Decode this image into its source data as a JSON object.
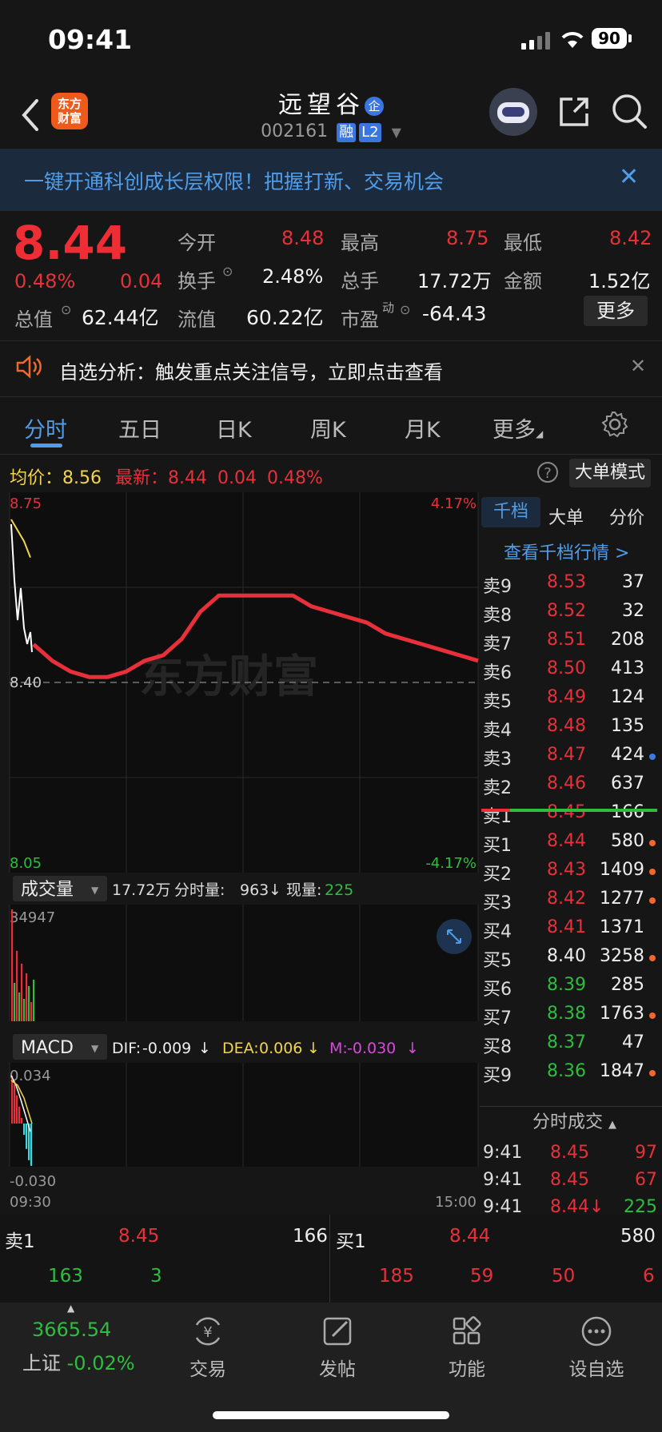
{
  "status_bar": {
    "time": "09:41",
    "battery": "90"
  },
  "header": {
    "logo_text": "东方\n财富",
    "stock_name": "远望谷",
    "badge_corp": "企",
    "stock_code": "002161",
    "tag_margin": "融",
    "tag_level": "L2"
  },
  "banner": {
    "text": "一键开通科创成长层权限！把握打新、交易机会"
  },
  "quote": {
    "price": "8.44",
    "change_pct": "0.48%",
    "change_abs": "0.04",
    "open_label": "今开",
    "open": "8.48",
    "high_label": "最高",
    "high": "8.75",
    "low_label": "最低",
    "low": "8.42",
    "turnover_label": "换手",
    "turnover": "2.48%",
    "volume_label": "总手",
    "volume": "17.72万",
    "amount_label": "金额",
    "amount": "1.52亿",
    "mktcap_label": "总值",
    "mktcap": "62.44亿",
    "float_label": "流值",
    "float": "60.22亿",
    "pe_label": "市盈",
    "pe_sup": "动",
    "pe": "-64.43",
    "more_label": "更多"
  },
  "notice": {
    "text": "自选分析：触发重点关注信号，立即点击查看"
  },
  "tabs": [
    {
      "label": "分时",
      "active": true
    },
    {
      "label": "五日"
    },
    {
      "label": "日K"
    },
    {
      "label": "周K"
    },
    {
      "label": "月K"
    },
    {
      "label": "更多"
    }
  ],
  "chart_info": {
    "avg_label": "均价：",
    "avg": "8.56",
    "latest_label": "最新：",
    "latest": "8.44",
    "latest_change": "0.04",
    "latest_pct": "0.48%",
    "big_order_mode": "大单模式",
    "watermark": "东方财富"
  },
  "chart_data": [
    {
      "type": "line",
      "title": "",
      "y_axis_left_labels": [
        "8.75",
        "8.40",
        "8.05"
      ],
      "y_axis_right_labels": [
        "4.17%",
        "-4.17%"
      ],
      "ylim": [
        8.05,
        8.75
      ],
      "reference_price": 8.4,
      "x_labels": [
        "09:30",
        "15:00"
      ],
      "series": [
        {
          "name": "",
          "values": [
            8.47,
            8.44,
            8.42,
            8.41,
            8.41,
            8.42,
            8.44,
            8.45,
            8.48,
            8.53,
            8.56,
            8.56,
            8.56,
            8.56,
            8.56,
            8.54,
            8.53,
            8.52,
            8.51,
            8.49,
            8.48,
            8.47,
            8.46,
            8.45,
            8.44
          ]
        },
        {
          "name": "",
          "values": [
            8.7,
            8.68,
            8.66,
            8.63
          ]
        }
      ]
    },
    {
      "type": "bar",
      "title": "成交量",
      "total": "17.72万",
      "minute_vol_label": "分时量:",
      "minute_vol": "963",
      "now_vol_label": "现量:",
      "now_vol": "225",
      "y_max_label": "34947",
      "values": [
        34947,
        12000,
        22000,
        9000,
        18000,
        7000,
        15000,
        11000,
        6000,
        13000
      ]
    },
    {
      "type": "bar",
      "title": "MACD",
      "dif_label": "DIF:",
      "dif": "-0.009",
      "dea_label": "DEA:",
      "dea": "0.006",
      "m_label": "M:",
      "m": "-0.030",
      "y_labels": [
        "0.034",
        "-0.030"
      ],
      "values": [
        0.034,
        0.028,
        0.02,
        0.012,
        0.004,
        -0.008,
        -0.018,
        -0.026,
        -0.03
      ]
    }
  ],
  "order_panel": {
    "tabs": [
      "千档",
      "大单",
      "分价"
    ],
    "link": "查看千档行情 >",
    "asks": [
      {
        "label": "卖9",
        "price": "8.53",
        "vol": "37"
      },
      {
        "label": "卖8",
        "price": "8.52",
        "vol": "32"
      },
      {
        "label": "卖7",
        "price": "8.51",
        "vol": "208"
      },
      {
        "label": "卖6",
        "price": "8.50",
        "vol": "413"
      },
      {
        "label": "卖5",
        "price": "8.49",
        "vol": "124"
      },
      {
        "label": "卖4",
        "price": "8.48",
        "vol": "135"
      },
      {
        "label": "卖3",
        "price": "8.47",
        "vol": "424"
      },
      {
        "label": "卖2",
        "price": "8.46",
        "vol": "637"
      },
      {
        "label": "卖1",
        "price": "8.45",
        "vol": "166"
      }
    ],
    "bids": [
      {
        "label": "买1",
        "price": "8.44",
        "vol": "580"
      },
      {
        "label": "买2",
        "price": "8.43",
        "vol": "1409"
      },
      {
        "label": "买3",
        "price": "8.42",
        "vol": "1277"
      },
      {
        "label": "买4",
        "price": "8.41",
        "vol": "1371"
      },
      {
        "label": "买5",
        "price": "8.40",
        "vol": "3258"
      },
      {
        "label": "买6",
        "price": "8.39",
        "vol": "285"
      },
      {
        "label": "买7",
        "price": "8.38",
        "vol": "1763"
      },
      {
        "label": "买8",
        "price": "8.37",
        "vol": "47"
      },
      {
        "label": "买9",
        "price": "8.36",
        "vol": "1847"
      }
    ],
    "ticks_title": "分时成交",
    "ticks": [
      {
        "time": "9:41",
        "price": "8.45",
        "vol": "97"
      },
      {
        "time": "9:41",
        "price": "8.45",
        "vol": "67"
      },
      {
        "time": "9:41",
        "price": "8.44↓",
        "vol": "225"
      }
    ]
  },
  "bottom_book": {
    "ask_label": "卖1",
    "ask_price": "8.45",
    "ask_vol": "166",
    "bid_label": "买1",
    "bid_price": "8.44",
    "bid_vol": "580",
    "left_values": [
      "163",
      "3"
    ],
    "right_values": [
      "185",
      "59",
      "50",
      "6"
    ]
  },
  "nav": {
    "index_value": "3665.54",
    "index_name": "上证",
    "index_change": "-0.02%",
    "items": [
      "交易",
      "发帖",
      "功能",
      "设自选"
    ]
  }
}
